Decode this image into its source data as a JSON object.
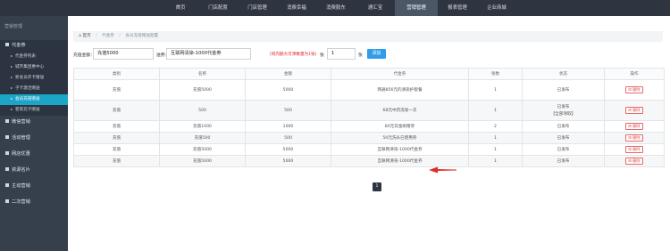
{
  "top_nav": {
    "items": [
      {
        "label": "首页",
        "active": false
      },
      {
        "label": "门店配置",
        "active": false
      },
      {
        "label": "门店管理",
        "active": false
      },
      {
        "label": "消费幸福",
        "active": false
      },
      {
        "label": "消费股东",
        "active": false
      },
      {
        "label": "通汇宝",
        "active": false
      },
      {
        "label": "营销管理",
        "active": true
      },
      {
        "label": "报表管理",
        "active": false
      },
      {
        "label": "企业商城",
        "active": false
      }
    ]
  },
  "sidebar": {
    "title": "营销管理",
    "groups": [
      {
        "label": "代金券",
        "open": true
      },
      {
        "label": "微信营销"
      },
      {
        "label": "活动管理"
      },
      {
        "label": "网店优惠"
      },
      {
        "label": "资源名片"
      },
      {
        "label": "主动营销"
      },
      {
        "label": "二次营销"
      }
    ],
    "sub_items": [
      {
        "label": "代金券列表",
        "active": false
      },
      {
        "label": "城市集团惠中心",
        "active": false
      },
      {
        "label": "新会员开卡赠送",
        "active": false
      },
      {
        "label": "子卡激活赠送",
        "active": false
      },
      {
        "label": "会员充值赠送",
        "active": true
      },
      {
        "label": "客帮充卡赠送",
        "active": false
      }
    ]
  },
  "breadcrumb": [
    "首页",
    "代金券",
    "会员充值赠送配置"
  ],
  "filter": {
    "recharge_label": "充值金额：",
    "recharge_value": "充值5000",
    "voucher_label": "送券：",
    "voucher_value": "互联网清染-1000代金券",
    "warning": "(同内额大可添数量为1张)",
    "qty_label": "张",
    "qty_value": "1",
    "unit": "张",
    "add_button": "添加"
  },
  "table": {
    "headers": [
      "类别",
      "名称",
      "金额",
      "代金券",
      "张数",
      "状态",
      "操作"
    ],
    "rows": [
      {
        "cat": "充值",
        "name": "充值5000",
        "amount": "5000",
        "voucher": "网通856元的清染护套餐",
        "qty": "1",
        "status": "已发布",
        "status2": "",
        "action": "删除"
      },
      {
        "cat": "充值",
        "name": "500",
        "amount": "500",
        "voucher": "68元中药洗发一次",
        "qty": "1",
        "status": "已发布",
        "status2": "【全部领取】",
        "action": "删除"
      },
      {
        "cat": "充值",
        "name": "充值1000",
        "amount": "1000",
        "voucher": "80元双金刷赠券",
        "qty": "2",
        "status": "已发布",
        "status2": "",
        "action": "删除"
      },
      {
        "cat": "充值",
        "name": "充值500",
        "amount": "500",
        "voucher": "50元洗头已使用券",
        "qty": "1",
        "status": "已发布",
        "status2": "",
        "action": "删除"
      },
      {
        "cat": "充值",
        "name": "充值5000",
        "amount": "5000",
        "voucher": "互联网清染-1000代金券",
        "qty": "1",
        "status": "已发布",
        "status2": "",
        "action": "删除"
      },
      {
        "cat": "充值",
        "name": "充值5000",
        "amount": "5000",
        "voucher": "互联网清染-1000代金券",
        "qty": "1",
        "status": "已发布",
        "status2": "",
        "action": "删除"
      }
    ]
  },
  "pagination": {
    "current": "1"
  },
  "colors": {
    "nav_bg": "#2f3540",
    "sidebar_bg": "#36404d",
    "accent": "#1ba6c8",
    "button": "#2f9de8",
    "danger": "#e04848"
  }
}
